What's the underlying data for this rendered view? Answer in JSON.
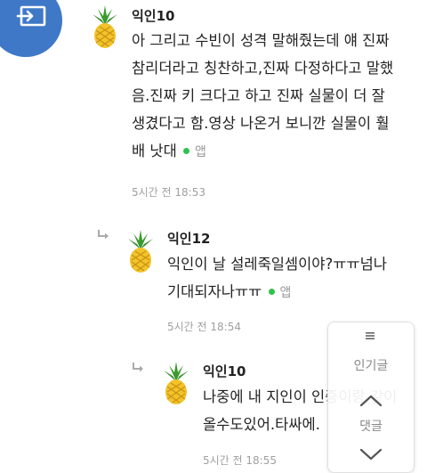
{
  "comments": [
    {
      "author": "익인10",
      "lines": [
        "아 그리고 수빈이 성격 말해줬는데 얘 진짜",
        "참리더라고 칭찬하고,진짜 다정하다고 말했",
        "음.진짜 키 크다고 하고 진짜 실물이 더 잘",
        "생겼다고 함.영상 나온거 보니깐 실물이 훨",
        "배 낫대"
      ],
      "app_label": "앱",
      "time": "5시간 전 18:53"
    },
    {
      "author": "익인12",
      "lines": [
        "익인이 날 설레죽일셈이야?ㅠㅠ넘나",
        "기대되자나ㅠㅠ"
      ],
      "app_label": "앱",
      "time": "5시간 전 18:54"
    },
    {
      "author": "익인10",
      "lines": [
        "나중에 내 지인이 인증이랑 같이",
        "올수도있어.타싸에."
      ],
      "time": "5시간 전 18:55"
    }
  ],
  "float_menu": {
    "popular_label": "인기글",
    "comments_label": "댓글"
  },
  "colors": {
    "cast_button": "#3e78c7",
    "app_dot": "#2fc24d",
    "muted_text": "#a0a0a0"
  },
  "icons": [
    "cast-icon",
    "menu-icon",
    "reply-arrow-icon",
    "pineapple-avatar-icon",
    "chevron-up-icon",
    "chevron-down-icon"
  ]
}
